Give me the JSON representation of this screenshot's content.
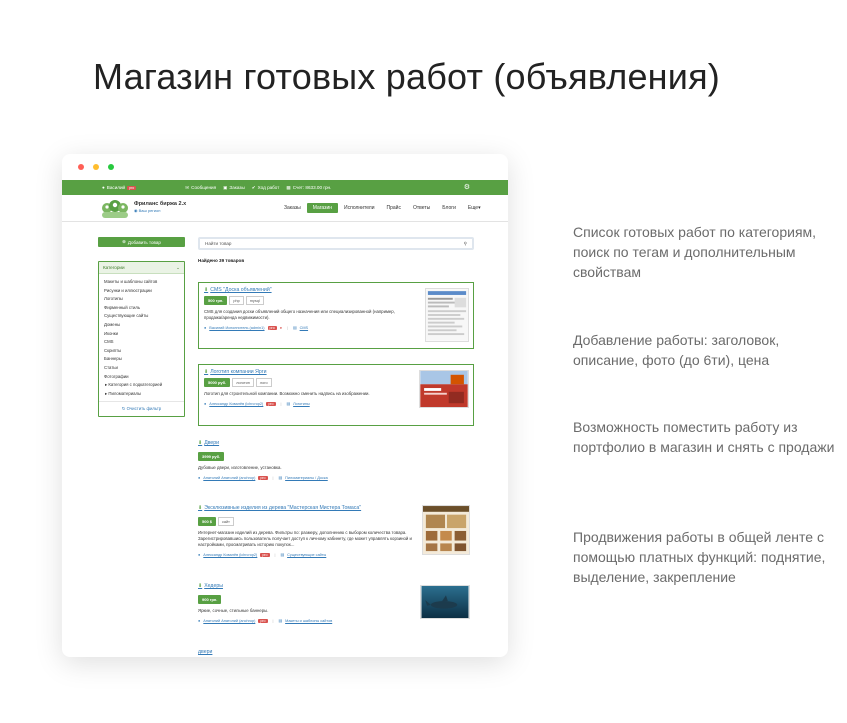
{
  "hero_title": "Магазин готовых работ (объявления)",
  "topbar": {
    "user": "Василий",
    "pro": "pro",
    "messages": "Сообщения",
    "orders": "Заказы",
    "progress": "Ход работ",
    "account": "Счет: 8633.00 грн."
  },
  "navbar": {
    "brand": "Фриланс биржа 2.x",
    "region": "Ваш регион",
    "menu": [
      "Заказы",
      "Магазин",
      "Исполнители",
      "Прайс",
      "Ответы",
      "Блоги",
      "Еще"
    ]
  },
  "sidebar": {
    "add_button": "Добавить товар",
    "categories_title": "Категории",
    "categories": [
      "Макеты и шаблоны сайтов",
      "Рисунки и иллюстрации",
      "Логотипы",
      "Фирменный стиль",
      "Существующие сайты",
      "Домены",
      "Иконки",
      "CMS",
      "Скрипты",
      "Баннеры",
      "Статьи",
      "Фотографии",
      "Категория с подкатегорией",
      "Пиломатериалы"
    ],
    "clear_filter": "Очистить фильтр"
  },
  "search": {
    "placeholder": "Найти товар"
  },
  "found_text": "Найдено 39 товаров",
  "items": [
    {
      "title": "CMS \"Доска объявлений\"",
      "price": "500 грн.",
      "tags": [
        "php",
        "mysql"
      ],
      "desc": "CMS для создания доски объявлений общего назначения или специализированной (например, продажа/аренда недвижимости).",
      "author": "Василий Исполнитель (admin1)",
      "pro": "pro",
      "category": "CMS"
    },
    {
      "title": "Логотип компании Ярги",
      "price": "5000 руб.",
      "tags": [
        "логотип",
        "лого"
      ],
      "desc": "Логотип для строительной компании. Возможно сменить надпись на изображении.",
      "author": "Александр Ковалёв (ichrcrop2)",
      "pro": "pro",
      "category": "Логотипы"
    },
    {
      "title": "Двери",
      "price": "3999 руб.",
      "tags": [],
      "desc": "Дубовые двери, изготовление, установка.",
      "author": "Анатолий Анатолий (anchrop)",
      "pro": "pro",
      "category": "Пиломатериалы / Доска"
    },
    {
      "title": "Эксклюзивные изделия из дерева \"Мастерская Мистера Томаса\"",
      "price": "500 $",
      "tags": [
        "сайт"
      ],
      "desc": "Интернет-магазин изделий из дерева. Фильтры по: размеру, дополнению с выбором количества товара. Зарегистрировавшись пользователь получает доступ к личному кабинету, где может управлять корзиной и настройками, просматривать историю покупок...",
      "author": "Александр Ковалёв (ichrcrop2)",
      "pro": "pro",
      "category": "Существующие сайты"
    },
    {
      "title": "Хедеры",
      "price": "900 грн.",
      "tags": [],
      "desc": "Яркие, сочные, стильные баннеры.",
      "author": "Анатолий Анатолий (anchrop)",
      "pro": "pro",
      "category": "Макеты и шаблоны сайтов"
    },
    {
      "title": "двери"
    }
  ],
  "features": [
    "Список готовых работ по категориям, поиск по тегам и дополнительным свойствам",
    "Добавление работы: заголовок, описание, фото (до 6ти), цена",
    "Возможность поместить работу из портфолио в магазин и снять с продажи",
    "Продвижения работы в общей ленте с помощью платных функций: поднятие, выделение, закрепление"
  ],
  "colors": {
    "accent": "#58a043",
    "link": "#337ab7",
    "pro": "#d9534f"
  }
}
